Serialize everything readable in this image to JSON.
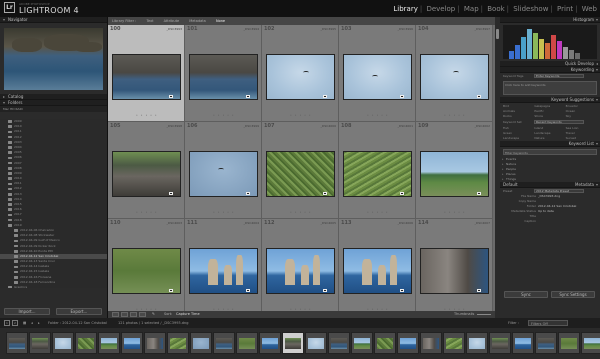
{
  "app": {
    "logo": "Lr",
    "subtitle": "ADOBE PHOTOSHOP",
    "name": "LIGHTROOM 4"
  },
  "modules": [
    "Library",
    "Develop",
    "Map",
    "Book",
    "Slideshow",
    "Print",
    "Web"
  ],
  "left_panel": {
    "navigator": "Navigator",
    "catalog": "Catalog",
    "folders": "Folders",
    "volume": "Mac HD RAID",
    "folders_list": [
      {
        "name": "2009",
        "count": "",
        "sel": false
      },
      {
        "name": "2010",
        "count": "",
        "sel": false
      },
      {
        "name": "2011",
        "count": "",
        "sel": false
      },
      {
        "name": "2012",
        "count": "",
        "sel": false
      },
      {
        "name": "2003",
        "count": "",
        "sel": false
      },
      {
        "name": "2004",
        "count": "",
        "sel": false
      },
      {
        "name": "2005",
        "count": "",
        "sel": false
      },
      {
        "name": "2006",
        "count": "",
        "sel": false
      },
      {
        "name": "2007",
        "count": "",
        "sel": false
      },
      {
        "name": "2008",
        "count": "",
        "sel": false
      },
      {
        "name": "2009",
        "count": "",
        "sel": false
      },
      {
        "name": "2010",
        "count": "",
        "sel": false
      },
      {
        "name": "2011",
        "count": "",
        "sel": false
      },
      {
        "name": "2012",
        "count": "",
        "sel": false
      },
      {
        "name": "2013",
        "count": "",
        "sel": false
      },
      {
        "name": "2014",
        "count": "",
        "sel": false
      },
      {
        "name": "2015",
        "count": "",
        "sel": false
      },
      {
        "name": "2016",
        "count": "",
        "sel": false
      },
      {
        "name": "2017",
        "count": "",
        "sel": false
      },
      {
        "name": "2018",
        "count": "",
        "sel": false
      },
      {
        "name": "2019",
        "count": "",
        "sel": false
      },
      {
        "name": "2012-04-06 Chalcedon",
        "count": "",
        "sel": false
      },
      {
        "name": "2012-04-08 Stickwater",
        "count": "",
        "sel": false
      },
      {
        "name": "2012-04-09 Gulf of Mexico",
        "count": "",
        "sel": false
      },
      {
        "name": "2012-04-09 Kicker Rock",
        "count": "",
        "sel": false
      },
      {
        "name": "2012-04-10 Punta Pitt",
        "count": "",
        "sel": false
      },
      {
        "name": "2012-04-12 San Cristobal",
        "count": "",
        "sel": true
      },
      {
        "name": "2012-04-13 Santa Cruz",
        "count": "",
        "sel": false
      },
      {
        "name": "2012-04-14 Isabela",
        "count": "",
        "sel": false
      },
      {
        "name": "2012-04-15 Isabela",
        "count": "",
        "sel": false
      },
      {
        "name": "2012-04-16 Floreana",
        "count": "",
        "sel": false
      },
      {
        "name": "2012-04-18 Fernandina",
        "count": "",
        "sel": false
      },
      {
        "name": "Graphics",
        "count": "",
        "sel": false
      }
    ],
    "import_btn": "Import...",
    "export_btn": "Export..."
  },
  "filterbar": {
    "label": "Library Filter :",
    "options": [
      "Text",
      "Attribute",
      "Metadata",
      "None"
    ],
    "active": "None"
  },
  "grid": {
    "cells": [
      {
        "num": "100",
        "file": "_DSC3993",
        "sel": true,
        "img": "t-rocks"
      },
      {
        "num": "101",
        "file": "_DSC3994",
        "sel": false,
        "img": "t-rocks"
      },
      {
        "num": "102",
        "file": "_DSC3995",
        "sel": false,
        "img": "t-sky"
      },
      {
        "num": "103",
        "file": "_DSC3996",
        "sel": false,
        "img": "t-sky"
      },
      {
        "num": "104",
        "file": "_DSC3997",
        "sel": false,
        "img": "t-sky"
      },
      {
        "num": "105",
        "file": "_DSC3998",
        "sel": false,
        "img": "t-lava"
      },
      {
        "num": "106",
        "file": "_DSC3999",
        "sel": false,
        "img": "t-sky2"
      },
      {
        "num": "107",
        "file": "_DSC4000",
        "sel": false,
        "img": "t-green"
      },
      {
        "num": "108",
        "file": "_DSC4001",
        "sel": false,
        "img": "t-green2"
      },
      {
        "num": "109",
        "file": "_DSC4002",
        "sel": false,
        "img": "t-shore"
      },
      {
        "num": "110",
        "file": "_DSC4003",
        "sel": false,
        "img": "t-green3"
      },
      {
        "num": "111",
        "file": "_DSC4004",
        "sel": false,
        "img": "t-sea"
      },
      {
        "num": "112",
        "file": "_DSC4005",
        "sel": false,
        "img": "t-sea"
      },
      {
        "num": "113",
        "file": "_DSC4006",
        "sel": false,
        "img": "t-sea"
      },
      {
        "num": "114",
        "file": "_DSC4007",
        "sel": false,
        "img": "t-cliff"
      }
    ],
    "sort_label": "Sort:",
    "sort_value": "Capture Time",
    "thumbnails_label": "Thumbnails"
  },
  "right_panel": {
    "histogram": "Histogram",
    "preset_label": "Saved Preset",
    "quick_develop": "Quick Develop",
    "keywording": "Keywording",
    "keyword_tags": "Keyword Tags",
    "keyword_tags_value": "Enter Keywords",
    "click_to_add": "Click here to add keywords",
    "keyword_suggestions": "Keyword Suggestions",
    "suggestions": [
      "Bird",
      "Galapagos",
      "Ecuador",
      "Animals",
      "Pacific",
      "Ocean",
      "Rocks",
      "Shore",
      "Sky"
    ],
    "keyword_set": "Keyword Set",
    "keyword_set_value": "Recent Keywords",
    "set_items": [
      "Fish",
      "Island",
      "Sea Lion",
      "Green",
      "Landscape",
      "Travel",
      "Landscape",
      "Nature",
      "Sunset"
    ],
    "keyword_list": "Keyword List",
    "filter_keywords": "Filter Keywords",
    "kw_items": [
      "Events",
      "Nature",
      "People",
      "Places",
      "Things"
    ],
    "default": "Default",
    "metadata": "Metadata",
    "preset": "Preset",
    "preset_value": "2012 Metadata Preset",
    "meta_rows": [
      {
        "k": "File Name",
        "v": "_DSC3993.dng"
      },
      {
        "k": "Copy Name",
        "v": ""
      },
      {
        "k": "Folder",
        "v": "2012-04-12 San Cristobal"
      },
      {
        "k": "Metadata Status",
        "v": "Up to date"
      },
      {
        "k": "Title",
        "v": ""
      },
      {
        "k": "Caption",
        "v": ""
      }
    ],
    "sync_btn": "Sync",
    "sync_settings_btn": "Sync Settings"
  },
  "filmstrip_bar": {
    "source": "Folder : 2012-04-12 San Cristobal",
    "count": "121 photos / 1 selected / _DSC3993.dng",
    "filter": "Filter :",
    "filter_value": "Filters Off"
  }
}
